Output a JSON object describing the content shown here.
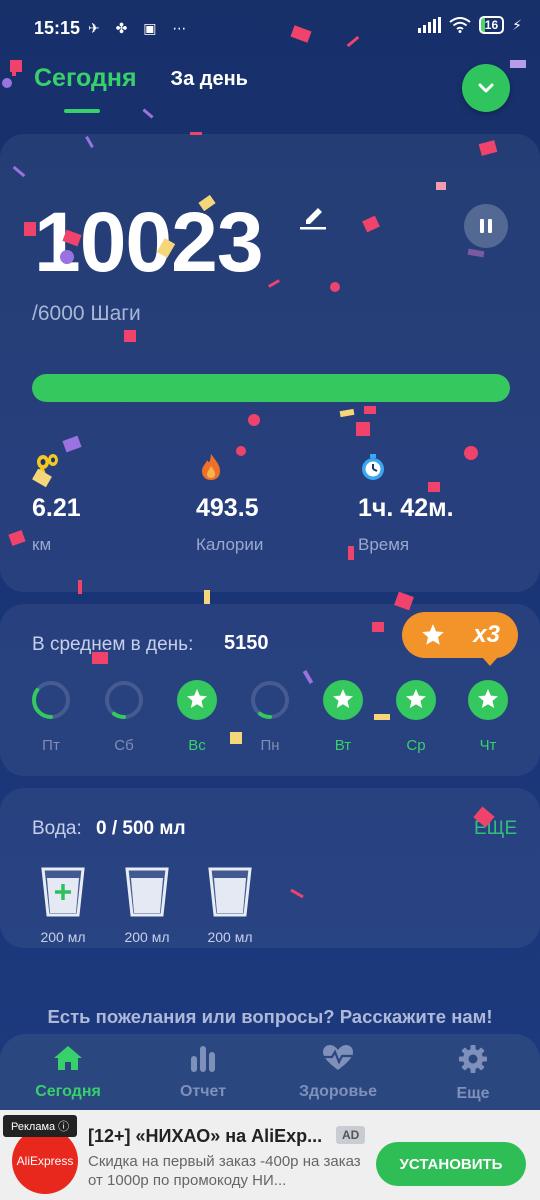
{
  "status_bar": {
    "time": "15:15",
    "icons": "✈ ✤ ▣ ⋯",
    "battery": "16"
  },
  "tabs": {
    "today": "Сегодня",
    "by_day": "За день"
  },
  "steps": {
    "value": "10023",
    "goal": "/6000 Шаги",
    "progress_fraction": 1.0
  },
  "metrics": [
    {
      "icon": "footsteps-icon",
      "value": "6.21",
      "label": "км"
    },
    {
      "icon": "fire-icon",
      "value": "493.5",
      "label": "Калории"
    },
    {
      "icon": "stopwatch-icon",
      "value": "1ч. 42м.",
      "label": "Время"
    }
  ],
  "week": {
    "avg_label": "В среднем в день:",
    "avg_value": "5150",
    "streak_badge": "x3",
    "days": [
      {
        "name": "Пт",
        "state": "partial",
        "progress": 0.35
      },
      {
        "name": "Сб",
        "state": "partial",
        "progress": 0.1
      },
      {
        "name": "Вс",
        "state": "done"
      },
      {
        "name": "Пн",
        "state": "partial",
        "progress": 0.1
      },
      {
        "name": "Вт",
        "state": "done"
      },
      {
        "name": "Ср",
        "state": "done"
      },
      {
        "name": "Чт",
        "state": "done"
      }
    ]
  },
  "water": {
    "label": "Вода:",
    "value": "0 / 500 мл",
    "more": "ЕЩЕ",
    "glasses": [
      "200 мл",
      "200 мл",
      "200 мл"
    ]
  },
  "feedback": "Есть пожелания или вопросы? Расскажите нам!",
  "nav": [
    {
      "label": "Сегодня",
      "icon": "home-icon",
      "active": true
    },
    {
      "label": "Отчет",
      "icon": "bar-chart-icon",
      "active": false
    },
    {
      "label": "Здоровье",
      "icon": "heartbeat-icon",
      "active": false
    },
    {
      "label": "Еще",
      "icon": "gear-icon",
      "active": false
    }
  ],
  "ad": {
    "tag": "Реклама ⓘ",
    "logo": "AliExpress",
    "title": "[12+] «НИХАО» на AliExp...",
    "chip": "AD",
    "description": "Скидка на первый заказ -400р на заказ от 1000р по промокоду НИ...",
    "button": "УСТАНОВИТЬ"
  },
  "colors": {
    "accent": "#37d06a",
    "orange": "#f2942a",
    "background": "#1a3474"
  }
}
